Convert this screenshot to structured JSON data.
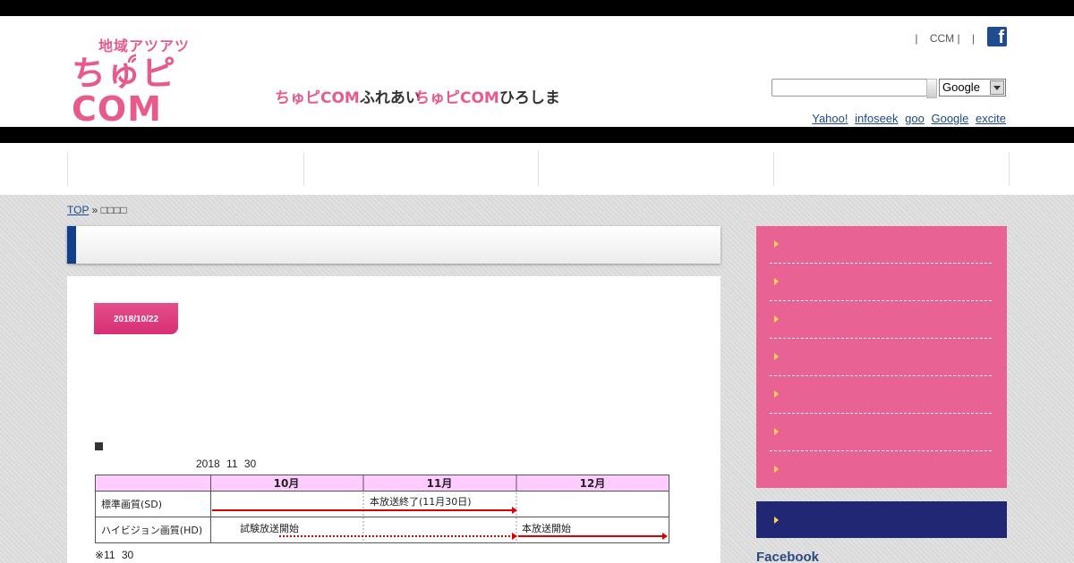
{
  "header": {
    "logo_sub": "地域アツアツ",
    "logo_main": "ちゅピCOM",
    "sublogo_1_brand": "ちゅピCOM",
    "sublogo_1_suffix": "ふれあい",
    "sublogo_2_brand": "ちゅピCOM",
    "sublogo_2_suffix": "ひろしま",
    "toplinks": [
      "|",
      "CCM |",
      "|",
      "|",
      "|"
    ],
    "facebook_glyph": "f",
    "search": {
      "value": "",
      "engine_selected": "Google"
    },
    "engine_links": [
      "Yahoo!",
      "infoseek",
      "goo",
      "Google",
      "excite"
    ]
  },
  "breadcrumb": {
    "home": "TOP",
    "separator": "»",
    "current": "□□□□"
  },
  "article": {
    "date": "2018/10/22",
    "bullet": "■",
    "date_line": "2018 11 30",
    "note": "※11 30",
    "schedule": {
      "months": [
        "10月",
        "11月",
        "12月"
      ],
      "rows": [
        {
          "label": "標準画質(SD)",
          "annotation": "本放送終了(11月30日)"
        },
        {
          "label": "ハイビジョン画質(HD)",
          "annotation_1": "試験放送開始",
          "annotation_2": "本放送開始"
        }
      ]
    }
  },
  "sidebar": {
    "facebook_heading": "Facebook"
  },
  "colors": {
    "brand_pink": "#e85a8e",
    "sidebar_pink": "#e86294",
    "sidebar_navy": "#212773",
    "accent_blue": "#123f8a",
    "table_header": "#ffccff",
    "arrow_red": "#dd0000"
  }
}
